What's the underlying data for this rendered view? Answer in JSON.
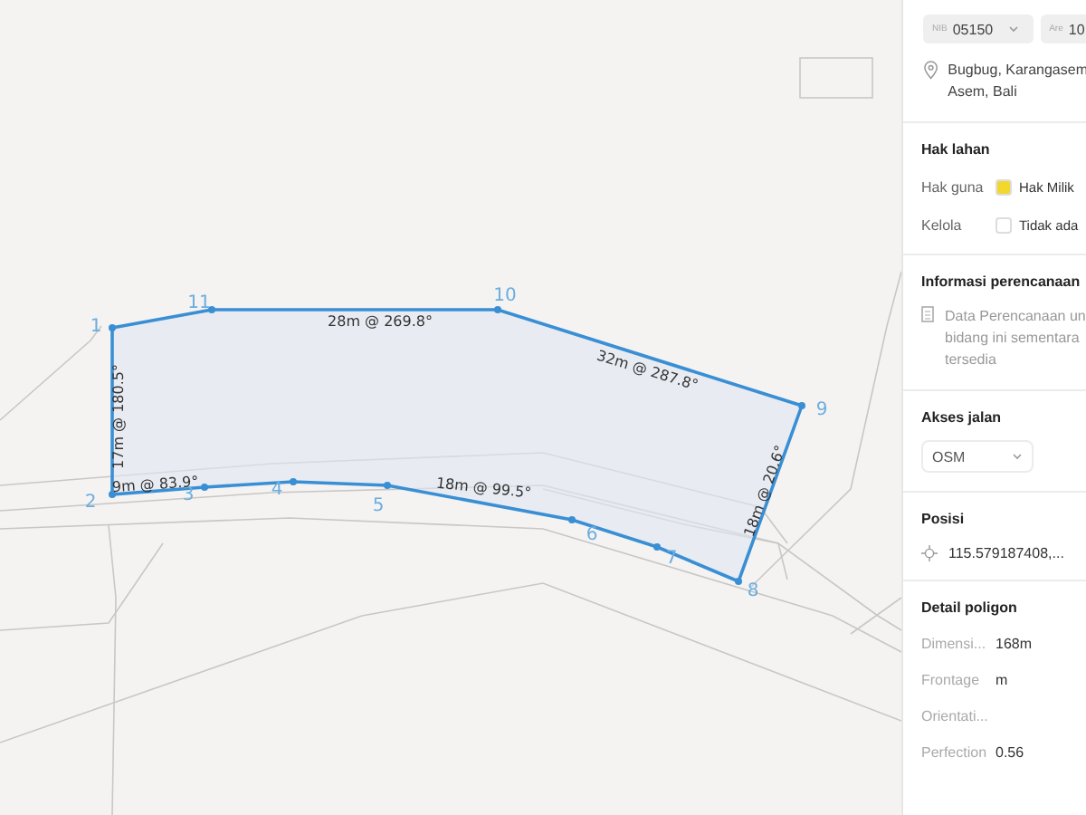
{
  "map": {
    "vertices": [
      {
        "label": "1"
      },
      {
        "label": "2"
      },
      {
        "label": "3"
      },
      {
        "label": "4"
      },
      {
        "label": "5"
      },
      {
        "label": "6"
      },
      {
        "label": "7"
      },
      {
        "label": "8"
      },
      {
        "label": "9"
      },
      {
        "label": "10"
      },
      {
        "label": "11"
      }
    ],
    "edges": [
      {
        "label": "17m @ 180.5°"
      },
      {
        "label": "9m @ 83.9°"
      },
      {
        "label": "18m @ 99.5°"
      },
      {
        "label": "18m @ 20.6°"
      },
      {
        "label": "32m @ 287.8°"
      },
      {
        "label": "28m @ 269.8°"
      }
    ]
  },
  "panel": {
    "parcel": {
      "id_prefix": "NIB",
      "id": "05150",
      "area_prefix": "Are",
      "area": "10"
    },
    "address_lines": [
      "Bugbug, Karangasem",
      "Asem, Bali"
    ],
    "land_rights": {
      "title": "Hak lahan",
      "rows": [
        {
          "label": "Hak guna",
          "value": "Hak Milik",
          "color": "#f2d82e"
        },
        {
          "label": "Kelola",
          "value": "Tidak ada",
          "color": "#ffffff"
        }
      ]
    },
    "planning": {
      "title": "Informasi perencanaan",
      "lines": [
        "Data Perencanaan un",
        "bidang ini sementara",
        "tersedia"
      ]
    },
    "road_access": {
      "title": "Akses jalan",
      "value": "OSM"
    },
    "position": {
      "title": "Posisi",
      "value": "115.579187408,..."
    },
    "polygon_detail": {
      "title": "Detail poligon",
      "rows": [
        {
          "label": "Dimensi...",
          "value": "168m"
        },
        {
          "label": "Frontage",
          "value": "m"
        },
        {
          "label": "Orientati..."
        },
        {
          "label": "Perfection",
          "value": "0.56"
        }
      ]
    }
  }
}
